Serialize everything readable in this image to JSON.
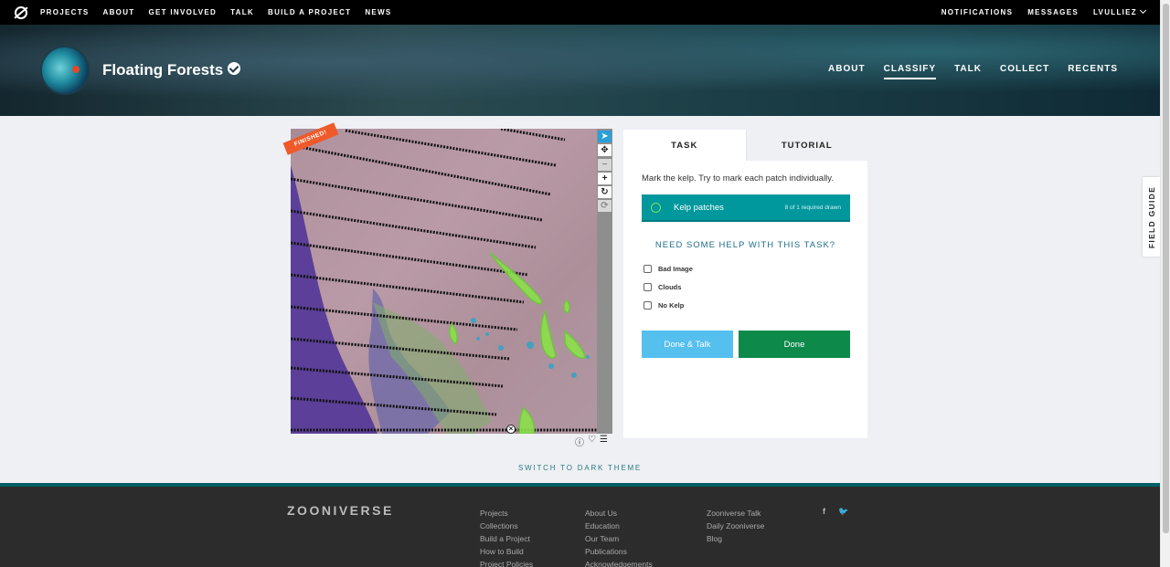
{
  "topnav": {
    "items": [
      "PROJECTS",
      "ABOUT",
      "GET INVOLVED",
      "TALK",
      "BUILD A PROJECT",
      "NEWS"
    ],
    "right": [
      "NOTIFICATIONS",
      "MESSAGES",
      "LVULLIEZ"
    ]
  },
  "project": {
    "title": "Floating Forests",
    "nav": [
      "ABOUT",
      "CLASSIFY",
      "TALK",
      "COLLECT",
      "RECENTS"
    ],
    "active_nav": "CLASSIFY"
  },
  "subject": {
    "ribbon": "FINISHED!"
  },
  "toolbar": {
    "tools": [
      "pointer-icon",
      "pan-icon",
      "zoom-out-icon",
      "zoom-in-icon",
      "rotate-icon",
      "reset-icon"
    ]
  },
  "task": {
    "tab_task": "TASK",
    "tab_tutorial": "TUTORIAL",
    "question": "Mark the kelp. Try to mark each patch individually.",
    "tool_label": "Kelp patches",
    "tool_count": "8 of 1 required drawn",
    "help": "NEED SOME HELP WITH THIS TASK?",
    "checkboxes": [
      "Bad Image",
      "Clouds",
      "No Kelp"
    ],
    "btn_done_talk": "Done & Talk",
    "btn_done": "Done"
  },
  "field_guide": "FIELD GUIDE",
  "theme_link": "SWITCH TO DARK THEME",
  "footer": {
    "brand": "ZOONIVERSE",
    "col1": [
      "Projects",
      "Collections",
      "Build a Project",
      "How to Build",
      "Project Policies"
    ],
    "col2": [
      "About Us",
      "Education",
      "Our Team",
      "Publications",
      "Acknowledgements"
    ],
    "col3": [
      "Zooniverse Talk",
      "Daily Zooniverse",
      "Blog"
    ],
    "social": [
      "f",
      "t"
    ]
  },
  "colors": {
    "accent": "#00979d",
    "done": "#0d8a4a",
    "talk": "#55bfee",
    "kelp": "#7ce25a",
    "ribbon": "#ef5a2a"
  }
}
